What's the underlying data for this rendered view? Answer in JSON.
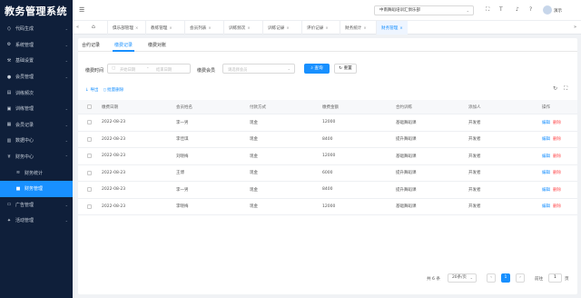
{
  "app": {
    "title": "教务管理系统"
  },
  "sidebar": {
    "items": [
      {
        "label": "代码生成",
        "icon": "code-icon"
      },
      {
        "label": "系统管理",
        "icon": "gear-icon"
      },
      {
        "label": "基础设置",
        "icon": "settings-icon"
      },
      {
        "label": "会员管理",
        "icon": "user-icon"
      },
      {
        "label": "训练频次",
        "icon": "chart-icon"
      },
      {
        "label": "训练管理",
        "icon": "dumbbell-icon"
      },
      {
        "label": "会员记录",
        "icon": "record-icon"
      },
      {
        "label": "数据中心",
        "icon": "data-icon"
      },
      {
        "label": "财务中心",
        "icon": "finance-icon"
      },
      {
        "label": "财务统计",
        "icon": "stats-icon"
      },
      {
        "label": "财务管理",
        "icon": "wallet-icon"
      },
      {
        "label": "广告管理",
        "icon": "ad-icon"
      },
      {
        "label": "活动管理",
        "icon": "activity-icon"
      }
    ],
    "active_index": 10
  },
  "header": {
    "org_select": "中南舞蹈培训汇俱乐部",
    "user_name": "演示"
  },
  "tabs": [
    {
      "label": "俱乐部管理"
    },
    {
      "label": "教练管理"
    },
    {
      "label": "会员列表"
    },
    {
      "label": "训练频次"
    },
    {
      "label": "训练记录"
    },
    {
      "label": "评价记录"
    },
    {
      "label": "财务统计"
    },
    {
      "label": "财务管理"
    }
  ],
  "subtabs": [
    {
      "label": "合约记录"
    },
    {
      "label": "缴费记录"
    },
    {
      "label": "缴费对账"
    }
  ],
  "filters": {
    "date_label": "缴费时间",
    "date_start_placeholder": "开始日期",
    "date_sep": "-",
    "date_end_placeholder": "结束日期",
    "member_label": "缴费会员",
    "member_placeholder": "请选择会员",
    "search_label": "查询",
    "reset_label": "重置"
  },
  "toolbar": {
    "export_label": "导出",
    "batch_delete_label": "批量删除"
  },
  "table": {
    "columns": [
      "缴费日期",
      "会员姓名",
      "付款方式",
      "缴费金额",
      "合约训练",
      "添加人",
      "操作"
    ],
    "rows": [
      {
        "date": "2022-08-23",
        "name": "李一男",
        "method": "现金",
        "amount": "12000",
        "course": "基础舞蹈课",
        "creator": "开发者"
      },
      {
        "date": "2022-08-23",
        "name": "李佳琪",
        "method": "现金",
        "amount": "8400",
        "course": "提升舞蹈课",
        "creator": "开发者"
      },
      {
        "date": "2022-08-23",
        "name": "刘晓梅",
        "method": "现金",
        "amount": "12000",
        "course": "基础舞蹈课",
        "creator": "开发者"
      },
      {
        "date": "2022-08-23",
        "name": "王博",
        "method": "现金",
        "amount": "6000",
        "course": "提升舞蹈课",
        "creator": "开发者"
      },
      {
        "date": "2022-08-23",
        "name": "李一男",
        "method": "现金",
        "amount": "8400",
        "course": "提升舞蹈课",
        "creator": "开发者"
      },
      {
        "date": "2022-08-23",
        "name": "李晓梅",
        "method": "现金",
        "amount": "12000",
        "course": "基础舞蹈课",
        "creator": "开发者"
      }
    ],
    "edit_label": "编辑",
    "delete_label": "删除"
  },
  "pagination": {
    "total_text": "共 6 条",
    "page_size": "20条/页",
    "prev": "‹",
    "current_page": "1",
    "next": "›",
    "goto_label": "前往",
    "goto_value": "1",
    "page_suffix": "页"
  },
  "colors": {
    "accent": "#1890ff",
    "sidebar_bg": "#0f1f3a",
    "danger": "#ff4d4f"
  }
}
